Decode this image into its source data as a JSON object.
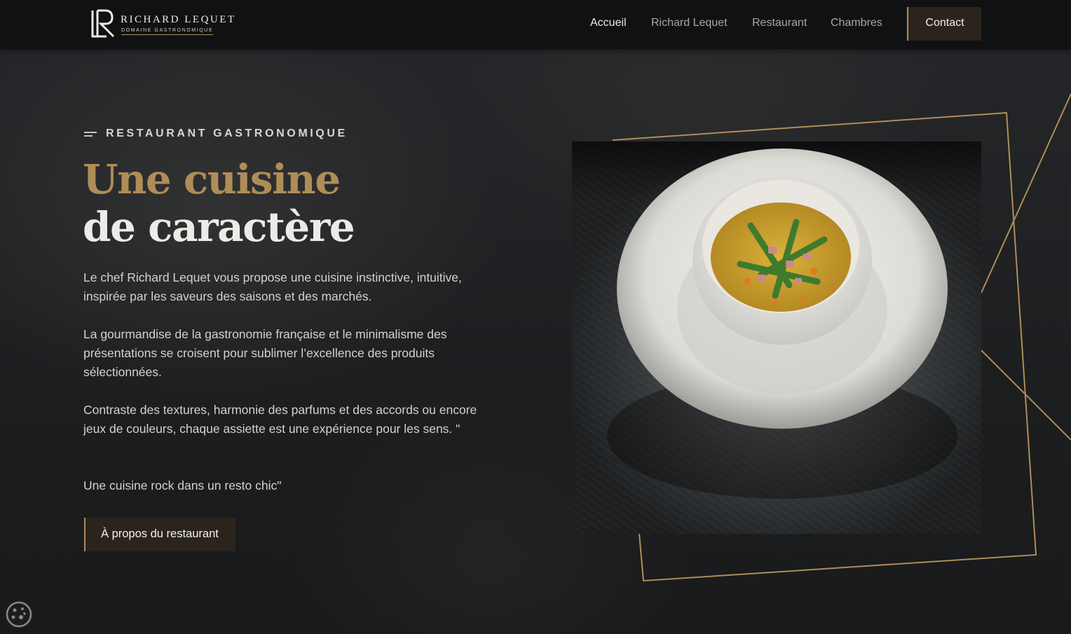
{
  "brand": {
    "name": "RICHARD LEQUET",
    "tagline": "DOMAINE GASTRONOMIQUE",
    "logo_icon": "lr-monogram-logo"
  },
  "nav": {
    "items": [
      {
        "label": "Accueil",
        "active": true
      },
      {
        "label": "Richard Lequet",
        "active": false
      },
      {
        "label": "Restaurant",
        "active": false
      },
      {
        "label": "Chambres",
        "active": false
      }
    ],
    "contact_label": "Contact"
  },
  "hero": {
    "eyebrow": "RESTAURANT GASTRONOMIQUE",
    "title_line1": "Une cuisine",
    "title_line2": "de caractère",
    "paragraphs": [
      "Le chef Richard Lequet vous propose une cuisine instinctive, intuitive, inspirée par les saveurs des saisons et des marchés.",
      "La gourmandise de la gastronomie française et le minimalisme des présentations se croisent pour sublimer l’excellence des produits sélectionnées.",
      "Contraste des textures, harmonie des parfums et des accords ou encore jeux de couleurs, chaque assiette est une expérience pour les sens. \"",
      "Une cuisine rock dans un resto chic\""
    ],
    "cta_label": "À propos du restaurant"
  },
  "image": {
    "subject": "dish-photo-asparagus-bowl"
  },
  "cookie": {
    "icon": "cookie-icon"
  },
  "colors": {
    "accent_gold": "#b08d57",
    "topbar": "#0f1112",
    "button_bg": "#2a241d",
    "background": "#1b1d1f",
    "text_light": "#ecebe8"
  }
}
